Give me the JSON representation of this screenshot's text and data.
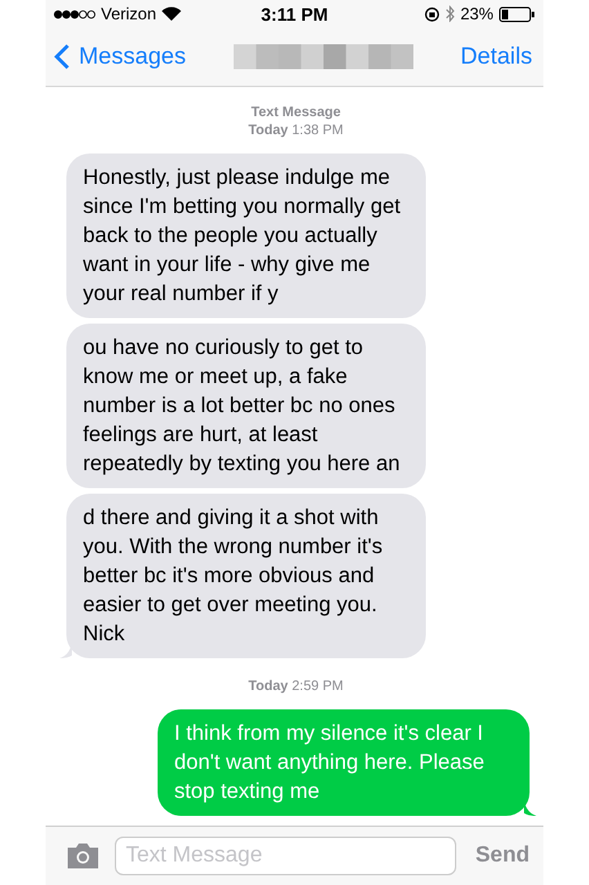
{
  "status_bar": {
    "carrier": "Verizon",
    "time": "3:11 PM",
    "battery": "23%"
  },
  "nav": {
    "back": "Messages",
    "action": "Details"
  },
  "thread": [
    {
      "kind": "header",
      "title": "Text Message",
      "day": "Today",
      "time": "1:38 PM"
    },
    {
      "kind": "incoming",
      "tail": false,
      "text": "Honestly, just please indulge me since I'm betting you normally get back to the people you actually want in your life - why give me your real number if y"
    },
    {
      "kind": "incoming",
      "tail": false,
      "text": "ou have no curiously to get to know me or meet up, a fake number is a lot better bc no ones feelings are hurt, at least repeatedly by texting you here an"
    },
    {
      "kind": "incoming",
      "tail": true,
      "text": "d there and giving it a shot with you. With the wrong number it's better bc it's more obvious and easier to get over meeting you. Nick"
    },
    {
      "kind": "header",
      "day": "Today",
      "time": "2:59 PM"
    },
    {
      "kind": "outgoing",
      "tail": true,
      "text": "I think from my silence it's clear I don't want anything here. Please stop texting me"
    }
  ],
  "composer": {
    "placeholder": "Text Message",
    "send": "Send",
    "send_disabled": true
  }
}
